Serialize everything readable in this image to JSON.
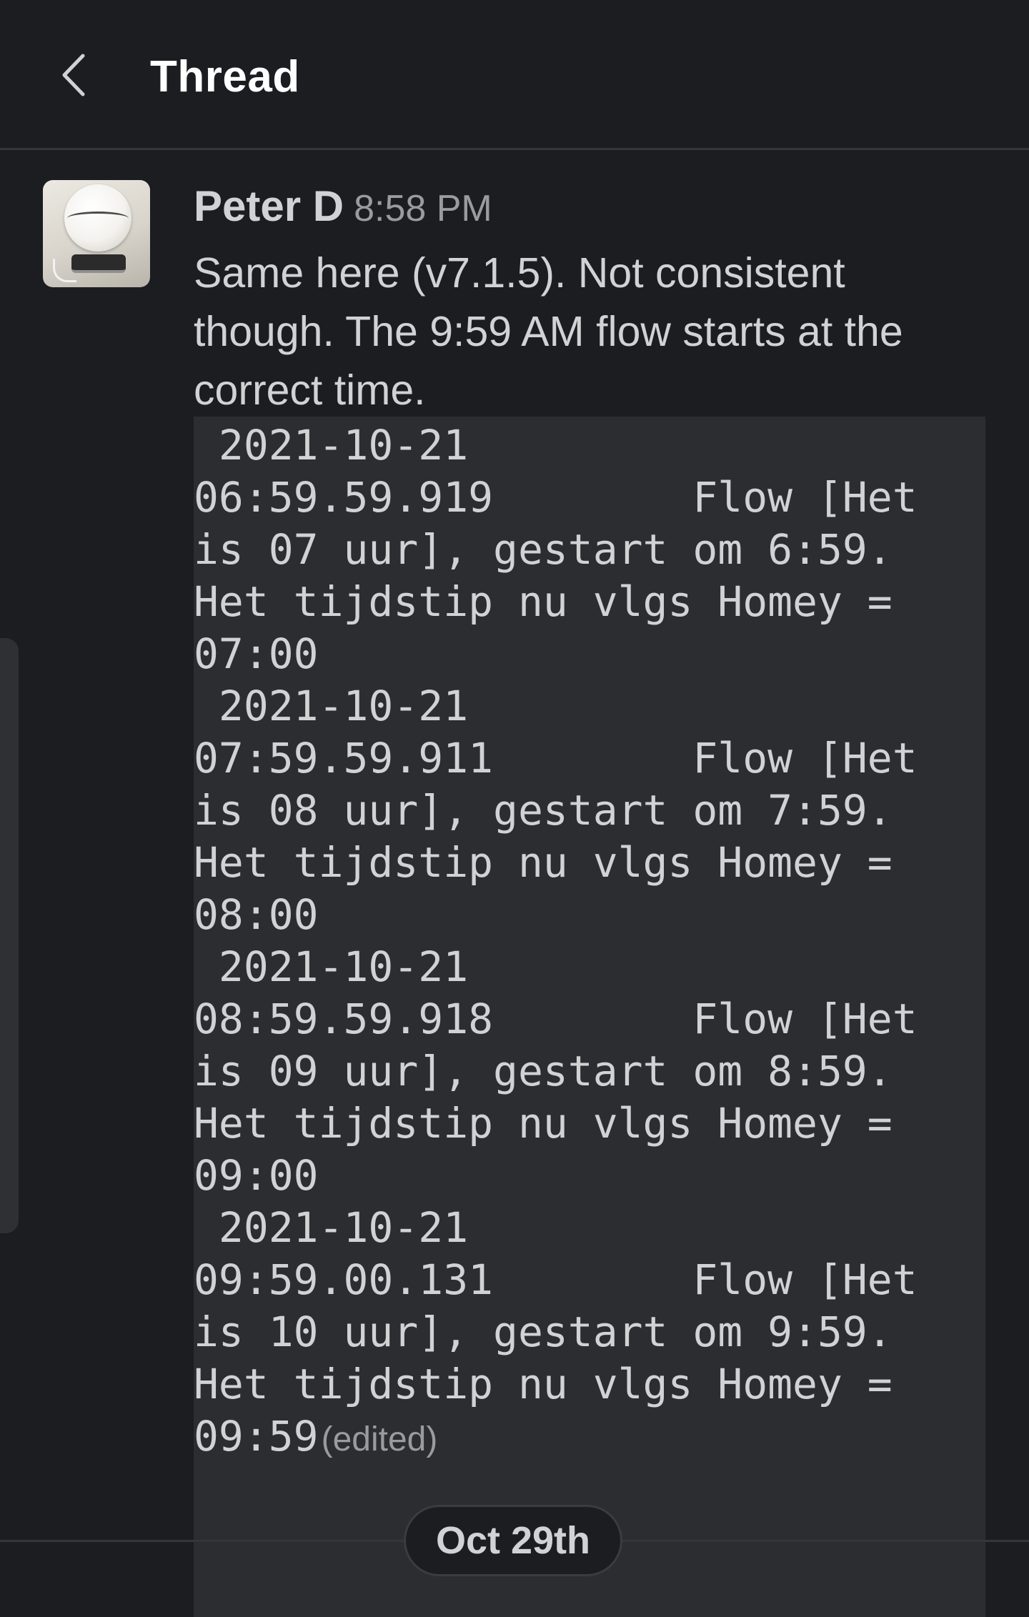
{
  "header": {
    "back_icon": "chevron-left-icon",
    "title": "Thread"
  },
  "message": {
    "author": "Peter D",
    "time": "8:58 PM",
    "avatar_icon": "user-avatar-lamp-photo",
    "text": "Same here (v7.1.5). Not consistent though. The 9:59 AM flow starts at the correct time.",
    "code_lines": [
      " 2021-10-21",
      "06:59.59.919        Flow [Het",
      "is 07 uur], gestart om 6:59.",
      "Het tijdstip nu vlgs Homey =",
      "07:00",
      " 2021-10-21",
      "07:59.59.911        Flow [Het",
      "is 08 uur], gestart om 7:59.",
      "Het tijdstip nu vlgs Homey =",
      "08:00",
      " 2021-10-21",
      "08:59.59.918        Flow [Het",
      "is 09 uur], gestart om 8:59.",
      "Het tijdstip nu vlgs Homey =",
      "09:00",
      " 2021-10-21",
      "09:59.00.131        Flow [Het",
      "is 10 uur], gestart om 9:59.",
      "Het tijdstip nu vlgs Homey =",
      "09:59"
    ],
    "edited_label": "(edited)"
  },
  "date_divider": {
    "label": "Oct 29th"
  },
  "colors": {
    "background": "#1b1d21",
    "code_background": "#2b2d31",
    "text": "#d1d2d3",
    "muted": "#9a9b9e"
  }
}
